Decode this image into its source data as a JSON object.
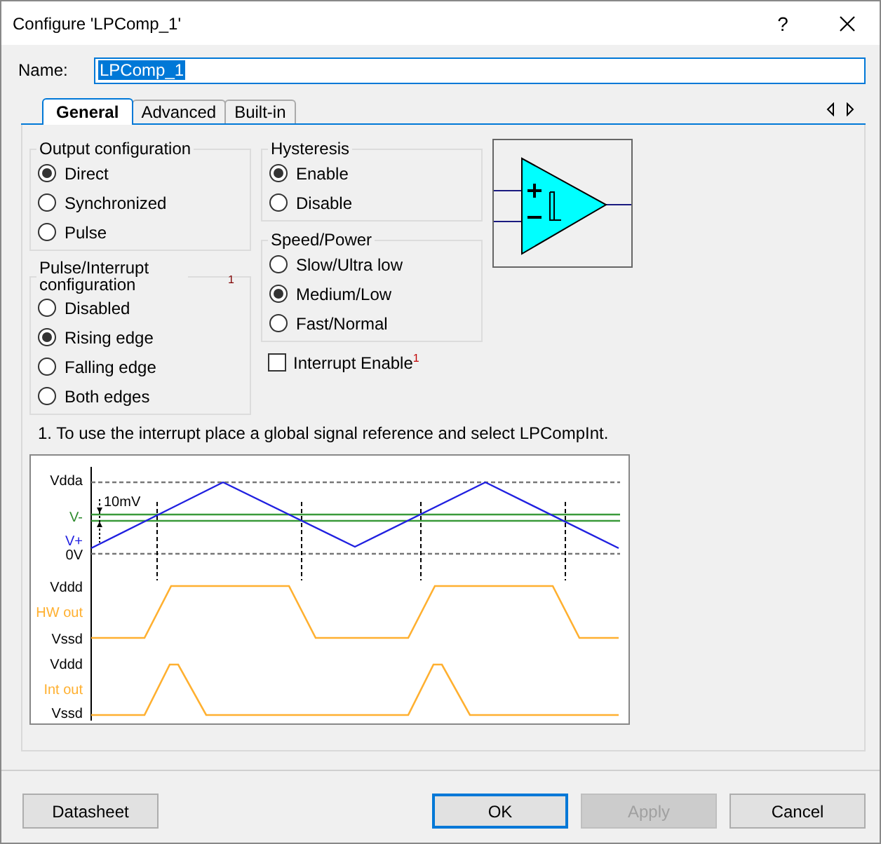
{
  "window": {
    "title": "Configure 'LPComp_1'",
    "help": "?"
  },
  "name_field": {
    "label": "Name:",
    "value": "LPComp_1",
    "selected": true
  },
  "tabs": [
    {
      "label": "General",
      "selected": true
    },
    {
      "label": "Advanced",
      "selected": false
    },
    {
      "label": "Built-in",
      "selected": false
    }
  ],
  "groups": [
    {
      "title": "Output configuration",
      "options": [
        {
          "label": "Direct",
          "selected": true
        },
        {
          "label": "Synchronized",
          "selected": false
        },
        {
          "label": "Pulse",
          "selected": false
        }
      ]
    },
    {
      "title": "Pulse/Interrupt configuration",
      "note": "1",
      "options": [
        {
          "label": "Disabled",
          "selected": false
        },
        {
          "label": "Rising edge",
          "selected": true
        },
        {
          "label": "Falling edge",
          "selected": false
        },
        {
          "label": "Both edges",
          "selected": false
        }
      ]
    },
    {
      "title": "Hysteresis",
      "options": [
        {
          "label": "Enable",
          "selected": true
        },
        {
          "label": "Disable",
          "selected": false
        }
      ]
    },
    {
      "title": "Speed/Power",
      "options": [
        {
          "label": "Slow/Ultra low",
          "selected": false
        },
        {
          "label": "Medium/Low",
          "selected": true
        },
        {
          "label": "Fast/Normal",
          "selected": false
        }
      ]
    }
  ],
  "interrupt_checkbox": {
    "label": "Interrupt Enable$^{1}$",
    "checked": false
  },
  "footnote": "1. To use the interrupt place a global signal reference and select LPCompInt.",
  "diagram": {
    "annotation": "10mV",
    "labels": [
      {
        "text": "Vdda",
        "color": "#000000"
      },
      {
        "text": "V-",
        "color": "#2e8b2e"
      },
      {
        "text": "V+",
        "color": "#2020e0"
      },
      {
        "text": "0V",
        "color": "#000000"
      },
      {
        "text": "Vddd",
        "color": "#000000"
      },
      {
        "text": "HW out",
        "color": "#ffb030"
      },
      {
        "text": "Vssd",
        "color": "#000000"
      },
      {
        "text": "Vddd",
        "color": "#000000"
      },
      {
        "text": "Int out",
        "color": "#ffb030"
      },
      {
        "text": "Vssd",
        "color": "#000000"
      }
    ]
  },
  "buttons": [
    {
      "label": "Datasheet",
      "default": false,
      "disabled": false
    },
    {
      "label": "OK",
      "default": true,
      "disabled": false
    },
    {
      "label": "Apply",
      "default": false,
      "disabled": true
    },
    {
      "label": "Cancel",
      "default": false,
      "disabled": false
    }
  ]
}
